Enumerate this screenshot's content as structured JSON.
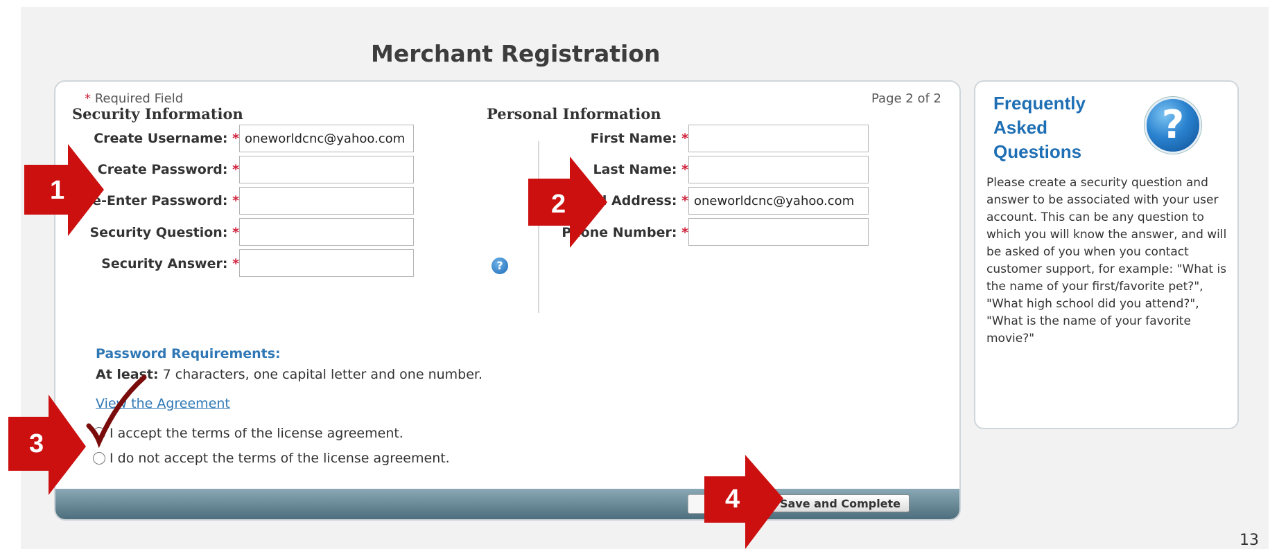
{
  "title": "Merchant Registration",
  "form": {
    "required_star": "*",
    "required_label": "Required Field",
    "page_indicator": "Page 2 of 2",
    "security": {
      "heading": "Security Information",
      "username_label": "Create Username:",
      "username_value": "oneworldcnc@yahoo.com",
      "password_label": "Create Password:",
      "reenter_label": "Re-Enter Password:",
      "question_label": "Security Question:",
      "answer_label": "Security Answer:"
    },
    "personal": {
      "heading": "Personal Information",
      "first_label": "First Name:",
      "last_label": "Last Name:",
      "email_label": "Email Address:",
      "email_value": "oneworldcnc@yahoo.com",
      "phone_label": "Phone Number:"
    },
    "password_req": {
      "heading": "Password Requirements:",
      "at_least": "At least:",
      "text": " 7 characters, one capital letter and one number."
    },
    "agreement_link": "View the Agreement",
    "accept_label": "I accept the terms of the license agreement.",
    "decline_label": "I do not accept the terms of the license agreement.",
    "save_button": "Save and Complete"
  },
  "faq": {
    "title_lines": [
      "Frequently",
      "Asked",
      "Questions"
    ],
    "icon": "question-icon",
    "body": "Please create a security question and answer to be associated with your user account. This can be any question to which you will know the answer, and will be asked of you when you contact customer support, for example: \"What is the name of your first/favorite pet?\", \"What high school did you attend?\", \"What is the name of your favorite movie?\""
  },
  "annotations": [
    "1",
    "2",
    "3",
    "4"
  ],
  "page_number": "13",
  "colors": {
    "annotation": "#cc1010",
    "link": "#2f78b5",
    "accent": "#1f6fb4",
    "required": "#d0213c"
  }
}
